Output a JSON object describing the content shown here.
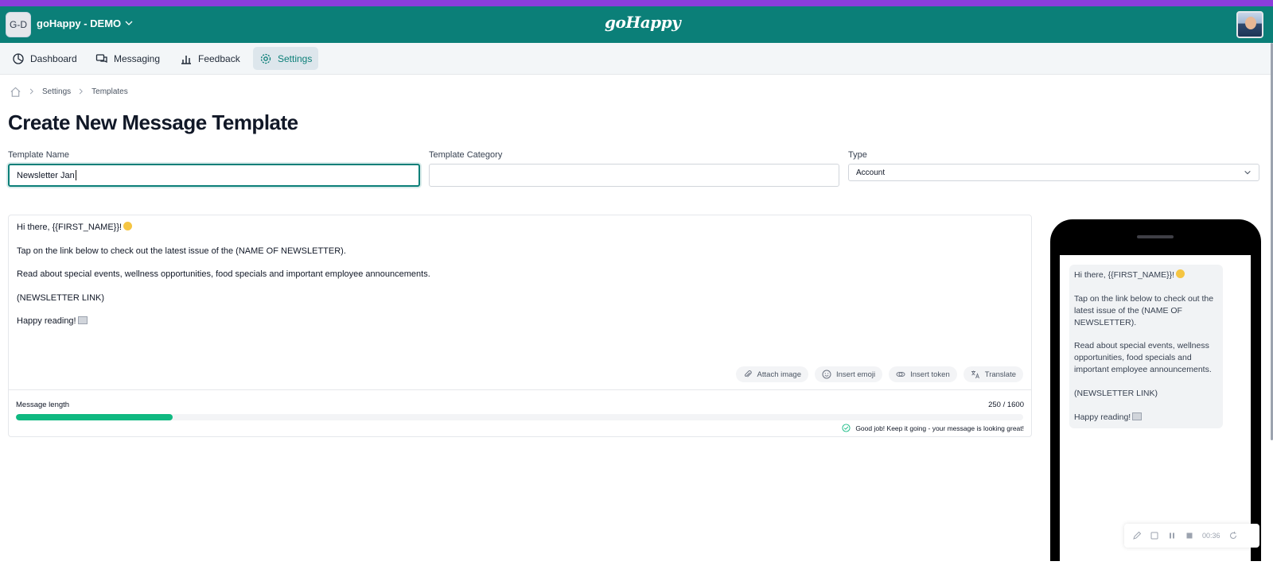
{
  "topbar": {
    "org_initials": "G-D",
    "org_name": "goHappy - DEMO",
    "logo_text": "goHappy",
    "brand_color": "#0b7f78",
    "stripe_color": "#8b3ddb"
  },
  "nav": {
    "items": [
      {
        "label": "Dashboard",
        "icon": "dashboard-icon"
      },
      {
        "label": "Messaging",
        "icon": "messaging-icon"
      },
      {
        "label": "Feedback",
        "icon": "feedback-icon"
      },
      {
        "label": "Settings",
        "icon": "gear-icon",
        "active": true
      }
    ]
  },
  "breadcrumb": {
    "items": [
      "Settings",
      "Templates"
    ]
  },
  "page": {
    "title": "Create New Message Template"
  },
  "form": {
    "template_name_label": "Template Name",
    "template_name_value": "Newsletter Jan",
    "template_category_label": "Template Category",
    "template_category_value": "",
    "type_label": "Type",
    "type_value": "Account"
  },
  "editor": {
    "lines": [
      "Hi there, {{FIRST_NAME}}!",
      "Tap on the link below to check out the latest issue of the (NAME OF NEWSLETTER).",
      "Read about special events, wellness opportunities, food specials and important employee announcements.",
      "(NEWSLETTER LINK)",
      "Happy reading!"
    ],
    "tools": [
      {
        "label": "Attach image",
        "icon": "paperclip-icon"
      },
      {
        "label": "Insert emoji",
        "icon": "emoji-icon"
      },
      {
        "label": "Insert token",
        "icon": "token-icon"
      },
      {
        "label": "Translate",
        "icon": "translate-icon"
      }
    ],
    "length_label": "Message length",
    "length_count": "250 / 1600",
    "length_fraction": 0.156,
    "length_note": "Good job! Keep it going - your message is looking great!",
    "progress_color": "#10b981"
  },
  "preview": {
    "paragraphs": [
      "Hi there, {{FIRST_NAME}}!",
      "Tap on the link below to check out the latest issue of the (NAME OF NEWSLETTER).",
      "Read about special events, wellness opportunities, food specials and important employee announcements.",
      "(NEWSLETTER LINK)",
      "Happy reading!"
    ]
  },
  "recorder": {
    "time": "00:36"
  }
}
